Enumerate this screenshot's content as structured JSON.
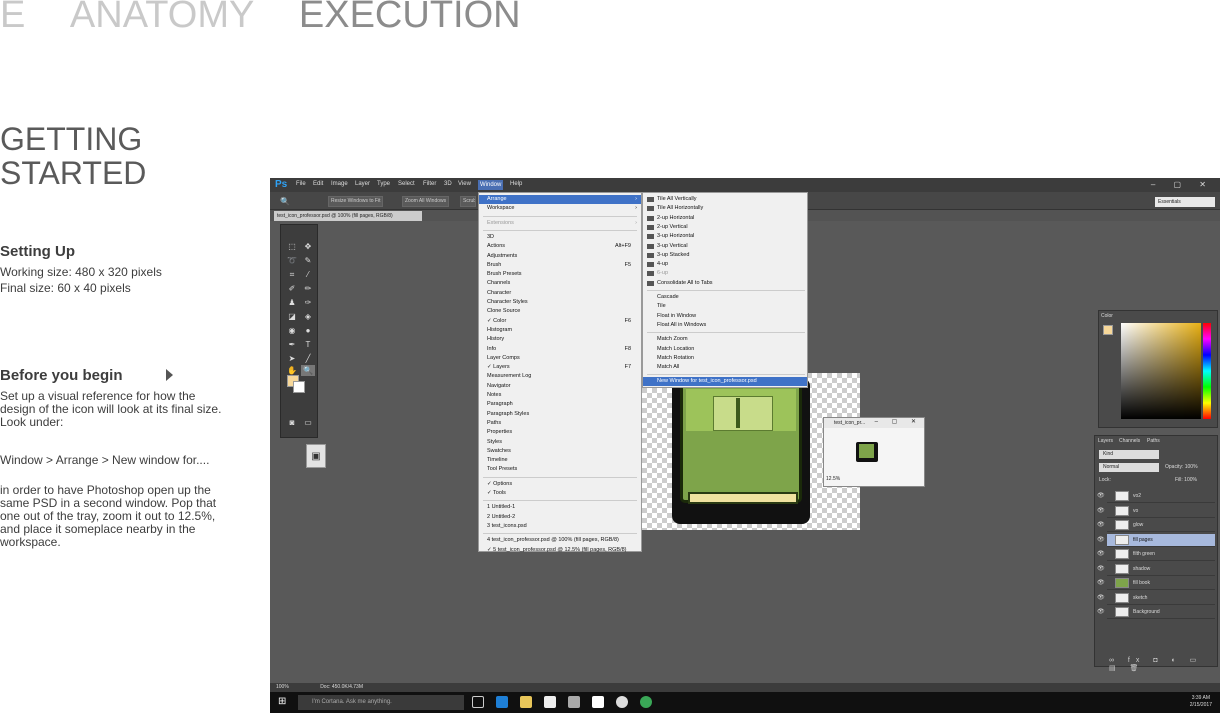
{
  "nav": {
    "partial": "E",
    "anatomy": "ANATOMY",
    "execution": "EXECUTION"
  },
  "page_title": "GETTING STARTED",
  "setup": {
    "heading": "Setting Up",
    "working": "Working size: 480 x 320 pixels",
    "final": "Final size: 60 x 40 pixels"
  },
  "before": {
    "heading": "Before you begin",
    "p1": "Set up a visual reference for how the design of the icon will look at its final size. Look under:",
    "p2": "Window > Arrange > New window for....",
    "p3": "in order to have Photoshop open up the same PSD in a second window. Pop that one out of the tray, zoom it out to 12.5%, and place it someplace nearby in the workspace."
  },
  "ps": {
    "logo": "Ps",
    "menu": [
      "File",
      "Edit",
      "Image",
      "Layer",
      "Type",
      "Select",
      "Filter",
      "3D",
      "View",
      "Window",
      "Help"
    ],
    "options": {
      "resize": "Resize Windows to Fit",
      "zoomall": "Zoom All Windows",
      "scrubby": "Scrubby Zoom"
    },
    "workspace": "Essentials",
    "doc_tab": "test_icon_professor.psd @ 100% (fill pages, RGB/8)",
    "window_menu": [
      {
        "label": "Arrange",
        "arrow": true,
        "hl": true
      },
      {
        "label": "Workspace",
        "arrow": true
      },
      {
        "sep": true
      },
      {
        "label": "Extensions",
        "arrow": true,
        "dis": true
      },
      {
        "sep": true
      },
      {
        "label": "3D"
      },
      {
        "label": "Actions",
        "sc": "Alt+F9"
      },
      {
        "label": "Adjustments"
      },
      {
        "label": "Brush",
        "sc": "F5"
      },
      {
        "label": "Brush Presets"
      },
      {
        "label": "Channels"
      },
      {
        "label": "Character"
      },
      {
        "label": "Character Styles"
      },
      {
        "label": "Clone Source"
      },
      {
        "label": "✓ Color",
        "sc": "F6"
      },
      {
        "label": "Histogram"
      },
      {
        "label": "History"
      },
      {
        "label": "Info",
        "sc": "F8"
      },
      {
        "label": "Layer Comps"
      },
      {
        "label": "✓ Layers",
        "sc": "F7"
      },
      {
        "label": "Measurement Log"
      },
      {
        "label": "Navigator"
      },
      {
        "label": "Notes"
      },
      {
        "label": "Paragraph"
      },
      {
        "label": "Paragraph Styles"
      },
      {
        "label": "Paths"
      },
      {
        "label": "Properties"
      },
      {
        "label": "Styles"
      },
      {
        "label": "Swatches"
      },
      {
        "label": "Timeline"
      },
      {
        "label": "Tool Presets"
      },
      {
        "sep": true
      },
      {
        "label": "✓ Options"
      },
      {
        "label": "✓ Tools"
      },
      {
        "sep": true
      },
      {
        "label": "1 Untitled-1"
      },
      {
        "label": "2 Untitled-2"
      },
      {
        "label": "3 test_icons.psd"
      },
      {
        "sep": true
      },
      {
        "label": "4 test_icon_professor.psd @ 100% (fill pages, RGB/8)"
      },
      {
        "label": "✓ 5 test_icon_professor.psd @ 12.5% (fill pages, RGB/8)"
      }
    ],
    "arrange_menu": [
      {
        "label": "Tile All Vertically",
        "sq": true
      },
      {
        "label": "Tile All Horizontally",
        "sq": true
      },
      {
        "label": "2-up Horizontal",
        "sq": true
      },
      {
        "label": "2-up Vertical",
        "sq": true
      },
      {
        "label": "3-up Horizontal",
        "sq": true
      },
      {
        "label": "3-up Vertical",
        "sq": true
      },
      {
        "label": "3-up Stacked",
        "sq": true
      },
      {
        "label": "4-up",
        "sq": true
      },
      {
        "label": "6-up",
        "sq": true,
        "dis": true
      },
      {
        "label": "Consolidate All to Tabs",
        "sq": true
      },
      {
        "sep": true
      },
      {
        "label": "Cascade"
      },
      {
        "label": "Tile"
      },
      {
        "label": "Float in Window"
      },
      {
        "label": "Float All in Windows"
      },
      {
        "sep": true
      },
      {
        "label": "Match Zoom"
      },
      {
        "label": "Match Location"
      },
      {
        "label": "Match Rotation"
      },
      {
        "label": "Match All"
      },
      {
        "sep": true
      },
      {
        "label": "New Window for test_icon_professor.psd",
        "hl": true
      }
    ],
    "second_window": {
      "title": "test_icon_pr...",
      "zoom": "12.5%"
    },
    "color_tab": "Color",
    "layers_tabs": [
      "Layers",
      "Channels",
      "Paths"
    ],
    "layers_kind": "Kind",
    "layers_mode": "Normal",
    "opacity": "Opacity: 100%",
    "lock": "Lock:",
    "fill": "Fill: 100%",
    "layers": [
      "vo2",
      "vo",
      "glow",
      "fill pages",
      "filth green",
      "shadow",
      "fill book",
      "sketch",
      "Background"
    ],
    "status_zoom": "100%",
    "status_doc": "Doc: 450.0K/4.73M",
    "cortana": "I'm Cortana. Ask me anything.",
    "time": "3:39 AM",
    "date": "2/15/2017"
  }
}
